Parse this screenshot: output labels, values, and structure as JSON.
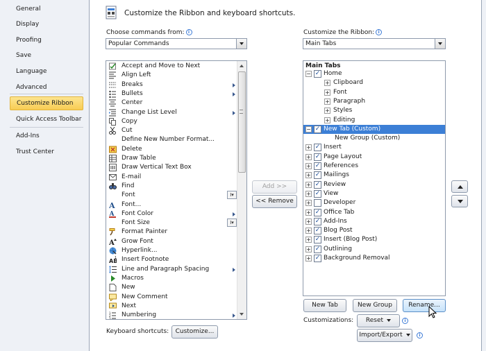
{
  "sidebar": {
    "items": [
      {
        "label": "General"
      },
      {
        "label": "Display"
      },
      {
        "label": "Proofing"
      },
      {
        "label": "Save"
      },
      {
        "label": "Language"
      },
      {
        "label": "Advanced"
      },
      {
        "label": "Customize Ribbon"
      },
      {
        "label": "Quick Access Toolbar"
      },
      {
        "label": "Add-Ins"
      },
      {
        "label": "Trust Center"
      }
    ],
    "active_index": 6
  },
  "header": {
    "title": "Customize the Ribbon and keyboard shortcuts."
  },
  "left": {
    "choose_label": "Choose commands from:",
    "choose_value": "Popular Commands",
    "commands": [
      {
        "label": "Accept and Move to Next",
        "icon": "accept-icon"
      },
      {
        "label": "Align Left",
        "icon": "align-left-icon"
      },
      {
        "label": "Breaks",
        "icon": "breaks-icon",
        "submenu": true
      },
      {
        "label": "Bullets",
        "icon": "bullets-icon",
        "submenu": true
      },
      {
        "label": "Center",
        "icon": "center-icon"
      },
      {
        "label": "Change List Level",
        "icon": "list-level-icon",
        "submenu": true
      },
      {
        "label": "Copy",
        "icon": "copy-icon"
      },
      {
        "label": "Cut",
        "icon": "cut-icon"
      },
      {
        "label": "Define New Number Format...",
        "icon": ""
      },
      {
        "label": "Delete",
        "icon": "delete-icon"
      },
      {
        "label": "Draw Table",
        "icon": "draw-table-icon"
      },
      {
        "label": "Draw Vertical Text Box",
        "icon": "text-box-icon"
      },
      {
        "label": "E-mail",
        "icon": "email-icon"
      },
      {
        "label": "Find",
        "icon": "find-icon"
      },
      {
        "label": "Font",
        "icon": "",
        "fontbox": true
      },
      {
        "label": "Font...",
        "icon": "font-dialog-icon"
      },
      {
        "label": "Font Color",
        "icon": "font-color-icon",
        "submenu": true
      },
      {
        "label": "Font Size",
        "icon": "",
        "fontbox": true
      },
      {
        "label": "Format Painter",
        "icon": "format-painter-icon"
      },
      {
        "label": "Grow Font",
        "icon": "grow-font-icon"
      },
      {
        "label": "Hyperlink...",
        "icon": "hyperlink-icon"
      },
      {
        "label": "Insert Footnote",
        "icon": "footnote-icon"
      },
      {
        "label": "Line and Paragraph Spacing",
        "icon": "line-spacing-icon",
        "submenu": true
      },
      {
        "label": "Macros",
        "icon": "macros-icon"
      },
      {
        "label": "New",
        "icon": "new-doc-icon"
      },
      {
        "label": "New Comment",
        "icon": "new-comment-icon"
      },
      {
        "label": "Next",
        "icon": "next-icon"
      },
      {
        "label": "Numbering",
        "icon": "numbering-icon",
        "submenu": true
      }
    ],
    "keyboard_label": "Keyboard shortcuts:",
    "customize_button": "Customize..."
  },
  "middle": {
    "add_button": "Add >>",
    "remove_button": "<< Remove"
  },
  "right": {
    "customize_label": "Customize the Ribbon:",
    "customize_value": "Main Tabs",
    "tree_header": "Main Tabs",
    "tree": [
      {
        "label": "Home",
        "level": 0,
        "expander": "−",
        "checked": true
      },
      {
        "label": "Clipboard",
        "level": 1,
        "expander": "+"
      },
      {
        "label": "Font",
        "level": 1,
        "expander": "+"
      },
      {
        "label": "Paragraph",
        "level": 1,
        "expander": "+"
      },
      {
        "label": "Styles",
        "level": 1,
        "expander": "+"
      },
      {
        "label": "Editing",
        "level": 1,
        "expander": "+"
      },
      {
        "label": "New Tab (Custom)",
        "level": 0,
        "expander": "−",
        "checked": true,
        "selected": true
      },
      {
        "label": "New Group (Custom)",
        "level": 1,
        "expander": ""
      },
      {
        "label": "Insert",
        "level": 0,
        "expander": "+",
        "checked": true
      },
      {
        "label": "Page Layout",
        "level": 0,
        "expander": "+",
        "checked": true
      },
      {
        "label": "References",
        "level": 0,
        "expander": "+",
        "checked": true
      },
      {
        "label": "Mailings",
        "level": 0,
        "expander": "+",
        "checked": true
      },
      {
        "label": "Review",
        "level": 0,
        "expander": "+",
        "checked": true
      },
      {
        "label": "View",
        "level": 0,
        "expander": "+",
        "checked": true
      },
      {
        "label": "Developer",
        "level": 0,
        "expander": "+",
        "checked": false
      },
      {
        "label": "Office Tab",
        "level": 0,
        "expander": "+",
        "checked": true
      },
      {
        "label": "Add-Ins",
        "level": 0,
        "expander": "+",
        "checked": true
      },
      {
        "label": "Blog Post",
        "level": 0,
        "expander": "+",
        "checked": true
      },
      {
        "label": "Insert (Blog Post)",
        "level": 0,
        "expander": "+",
        "checked": true
      },
      {
        "label": "Outlining",
        "level": 0,
        "expander": "+",
        "checked": true
      },
      {
        "label": "Background Removal",
        "level": 0,
        "expander": "+",
        "checked": true
      }
    ],
    "new_tab_button": "New Tab",
    "new_group_button": "New Group",
    "rename_button": "Rename...",
    "customizations_label": "Customizations:",
    "reset_button": "Reset",
    "import_export_button": "Import/Export"
  },
  "colors": {
    "accent": "#3c7fd6",
    "active_nav": "#f8cc53"
  }
}
